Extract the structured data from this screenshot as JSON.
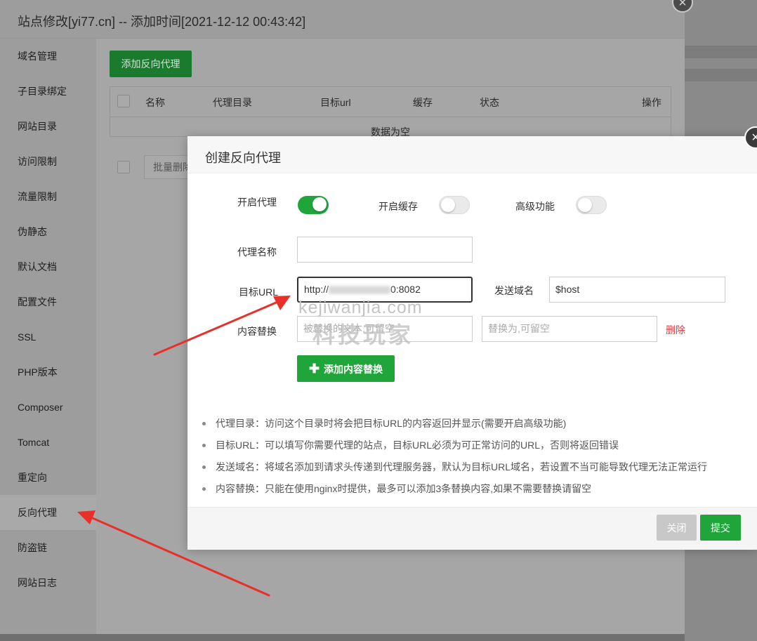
{
  "outer_dialog": {
    "title": "站点修改[yi77.cn] -- 添加时间[2021-12-12 00:43:42]",
    "close_glyph": "×",
    "add_proxy_button": "添加反向代理",
    "table": {
      "columns": [
        "名称",
        "代理目录",
        "目标url",
        "缓存",
        "状态",
        "操作"
      ],
      "empty_text": "数据为空"
    },
    "batch_select": "批量删除"
  },
  "sidebar": {
    "items": [
      {
        "label": "域名管理"
      },
      {
        "label": "子目录绑定"
      },
      {
        "label": "网站目录"
      },
      {
        "label": "访问限制"
      },
      {
        "label": "流量限制"
      },
      {
        "label": "伪静态"
      },
      {
        "label": "默认文档"
      },
      {
        "label": "配置文件"
      },
      {
        "label": "SSL"
      },
      {
        "label": "PHP版本"
      },
      {
        "label": "Composer"
      },
      {
        "label": "Tomcat"
      },
      {
        "label": "重定向"
      },
      {
        "label": "反向代理",
        "active": true
      },
      {
        "label": "防盗链"
      },
      {
        "label": "网站日志"
      }
    ]
  },
  "proxy_dialog": {
    "title": "创建反向代理",
    "close_glyph": "×",
    "toggles": {
      "enable_proxy": {
        "label": "开启代理",
        "on": true
      },
      "enable_cache": {
        "label": "开启缓存",
        "on": false
      },
      "advanced": {
        "label": "高级功能",
        "on": false
      }
    },
    "proxy_name": {
      "label": "代理名称",
      "value": ""
    },
    "target_url": {
      "label": "目标URL",
      "value_prefix": "http://",
      "value_suffix": "0:8082"
    },
    "send_domain": {
      "label": "发送域名",
      "value": "$host"
    },
    "content_replace": {
      "label": "内容替换",
      "find_placeholder": "被替换的文本,可留空",
      "replace_placeholder": "替换为,可留空",
      "delete_label": "删除"
    },
    "add_replace_button": "添加内容替换",
    "add_replace_icon": "plus-icon",
    "tips": [
      "代理目录：访问这个目录时将会把目标URL的内容返回并显示(需要开启高级功能)",
      "目标URL：可以填写你需要代理的站点，目标URL必须为可正常访问的URL，否则将返回错误",
      "发送域名：将域名添加到请求头传递到代理服务器，默认为目标URL域名，若设置不当可能导致代理无法正常运行",
      "内容替换：只能在使用nginx时提供，最多可以添加3条替换内容,如果不需要替换请留空"
    ],
    "footer": {
      "close": "关闭",
      "submit": "提交"
    }
  },
  "watermark": {
    "line1": "kejiwanjia.com",
    "line2": "科技玩家"
  },
  "colors": {
    "accent": "#20a53a",
    "danger": "#e0393e",
    "arrow": "#e8302a"
  }
}
